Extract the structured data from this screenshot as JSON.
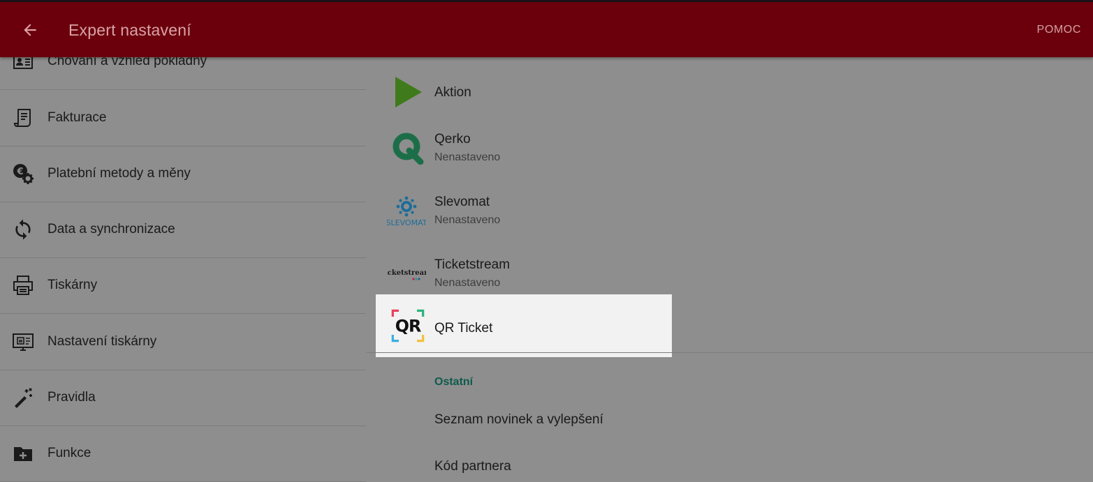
{
  "appbar": {
    "title": "Expert nastavení",
    "help_label": "POMOC",
    "background": "#6b000c"
  },
  "menu": {
    "items": [
      {
        "label": "Chování a vzhled pokladny",
        "icon": "id-card-icon"
      },
      {
        "label": "Fakturace",
        "icon": "invoice-icon"
      },
      {
        "label": "Platební metody a měny",
        "icon": "euro-gear-icon"
      },
      {
        "label": "Data a synchronizace",
        "icon": "sync-icon"
      },
      {
        "label": "Tiskárny",
        "icon": "printer-icon"
      },
      {
        "label": "Nastavení tiskárny",
        "icon": "printer-settings-icon"
      },
      {
        "label": "Pravidla",
        "icon": "magic-wand-icon"
      },
      {
        "label": "Funkce",
        "icon": "folder-plus-icon"
      }
    ]
  },
  "integrations": {
    "items": [
      {
        "name": "Aktion",
        "status": "",
        "logo": "aktion-play-logo"
      },
      {
        "name": "Qerko",
        "status": "Nenastaveno",
        "logo": "qerko-q-logo"
      },
      {
        "name": "Slevomat",
        "status": "Nenastaveno",
        "logo": "slevomat-logo",
        "logo_text": "SLEVOMAT"
      },
      {
        "name": "Ticketstream",
        "status": "Nenastaveno",
        "logo": "ticketstream-logo",
        "logo_text": "ticketstream"
      },
      {
        "name": "QR Ticket",
        "status": "",
        "logo": "qr-ticket-logo",
        "logo_text": "QR"
      }
    ]
  },
  "other": {
    "section_title": "Ostatní",
    "items": [
      {
        "label": "Seznam novinek a vylepšení"
      },
      {
        "label": "Kód partnera"
      }
    ]
  }
}
